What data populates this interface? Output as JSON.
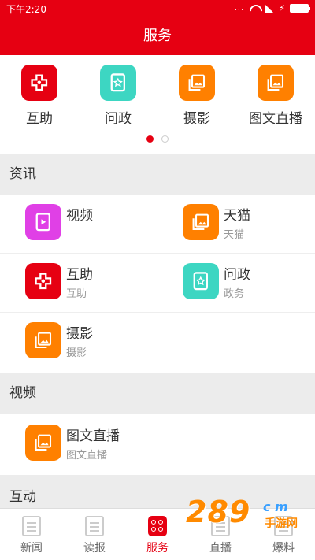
{
  "status_bar": {
    "time": "下午2:20",
    "dots": "..."
  },
  "header": {
    "title": "服务"
  },
  "quick_actions": [
    {
      "label": "互助",
      "icon": "cross-icon",
      "color": "#e60012"
    },
    {
      "label": "问政",
      "icon": "star-doc-icon",
      "color": "#3dd6c2"
    },
    {
      "label": "摄影",
      "icon": "gallery-icon",
      "color": "#ff8000"
    },
    {
      "label": "图文直播",
      "icon": "gallery-icon",
      "color": "#ff8000"
    }
  ],
  "pager": {
    "pages": 2,
    "active": 0
  },
  "sections": [
    {
      "title": "资讯",
      "items": [
        {
          "title": "视频",
          "subtitle": "",
          "icon": "play-doc-icon",
          "color": "#e040e6"
        },
        {
          "title": "天猫",
          "subtitle": "天猫",
          "icon": "gallery-icon",
          "color": "#ff8000"
        },
        {
          "title": "互助",
          "subtitle": "互助",
          "icon": "cross-icon",
          "color": "#e60012"
        },
        {
          "title": "问政",
          "subtitle": "政务",
          "icon": "star-doc-icon",
          "color": "#3dd6c2"
        },
        {
          "title": "摄影",
          "subtitle": "摄影",
          "icon": "gallery-icon",
          "color": "#ff8000"
        }
      ]
    },
    {
      "title": "视频",
      "items": [
        {
          "title": "图文直播",
          "subtitle": "图文直播",
          "icon": "gallery-icon",
          "color": "#ff8000"
        }
      ]
    },
    {
      "title": "互动",
      "items": []
    }
  ],
  "tabbar": [
    {
      "label": "新闻",
      "icon": "newspaper-icon",
      "active": false
    },
    {
      "label": "读报",
      "icon": "paper-icon",
      "active": false
    },
    {
      "label": "服务",
      "icon": "service-grid-icon",
      "active": true
    },
    {
      "label": "直播",
      "icon": "live-icon",
      "active": false
    },
    {
      "label": "爆料",
      "icon": "report-icon",
      "active": false
    }
  ],
  "watermark": {
    "number": "289",
    "suffix": "c m",
    "cn": "手游网"
  },
  "colors": {
    "brand": "#e60012",
    "section_bg": "#ececec"
  }
}
